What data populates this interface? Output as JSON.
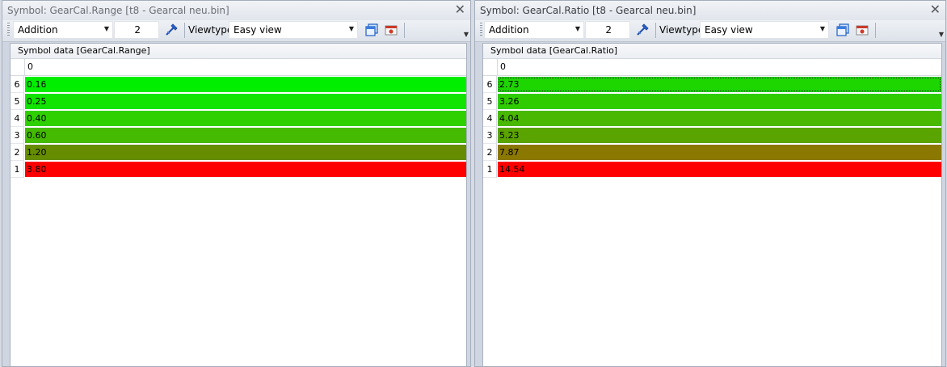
{
  "panels": [
    {
      "title": "Symbol: GearCal.Range [t8 - Gearcal neu.bin]",
      "toolbar": {
        "mode": "Addition",
        "step": "2",
        "viewtype_label": "Viewtype",
        "viewtype_value": "Easy view"
      },
      "content_header": "Symbol data [GearCal.Range]",
      "column_header": "0",
      "rows": [
        {
          "index": "6",
          "value": "0.16",
          "color": "#00ee00"
        },
        {
          "index": "5",
          "value": "0.25",
          "color": "#10e400"
        },
        {
          "index": "4",
          "value": "0.40",
          "color": "#2fd000"
        },
        {
          "index": "3",
          "value": "0.60",
          "color": "#44ba00"
        },
        {
          "index": "2",
          "value": "1.20",
          "color": "#668d00"
        },
        {
          "index": "1",
          "value": "3.80",
          "color": "#ff0000"
        }
      ]
    },
    {
      "title": "Symbol: GearCal.Ratio [t8 - Gearcal neu.bin]",
      "toolbar": {
        "mode": "Addition",
        "step": "2",
        "viewtype_label": "Viewtype",
        "viewtype_value": "Easy view"
      },
      "content_header": "Symbol data [GearCal.Ratio]",
      "column_header": "0",
      "rows": [
        {
          "index": "6",
          "value": "2.73",
          "color": "#1dd600"
        },
        {
          "index": "5",
          "value": "3.26",
          "color": "#2fcc00"
        },
        {
          "index": "4",
          "value": "4.04",
          "color": "#48b800"
        },
        {
          "index": "3",
          "value": "5.23",
          "color": "#5aa400"
        },
        {
          "index": "2",
          "value": "7.87",
          "color": "#8a7800"
        },
        {
          "index": "1",
          "value": "14.54",
          "color": "#ff0000"
        }
      ]
    }
  ]
}
